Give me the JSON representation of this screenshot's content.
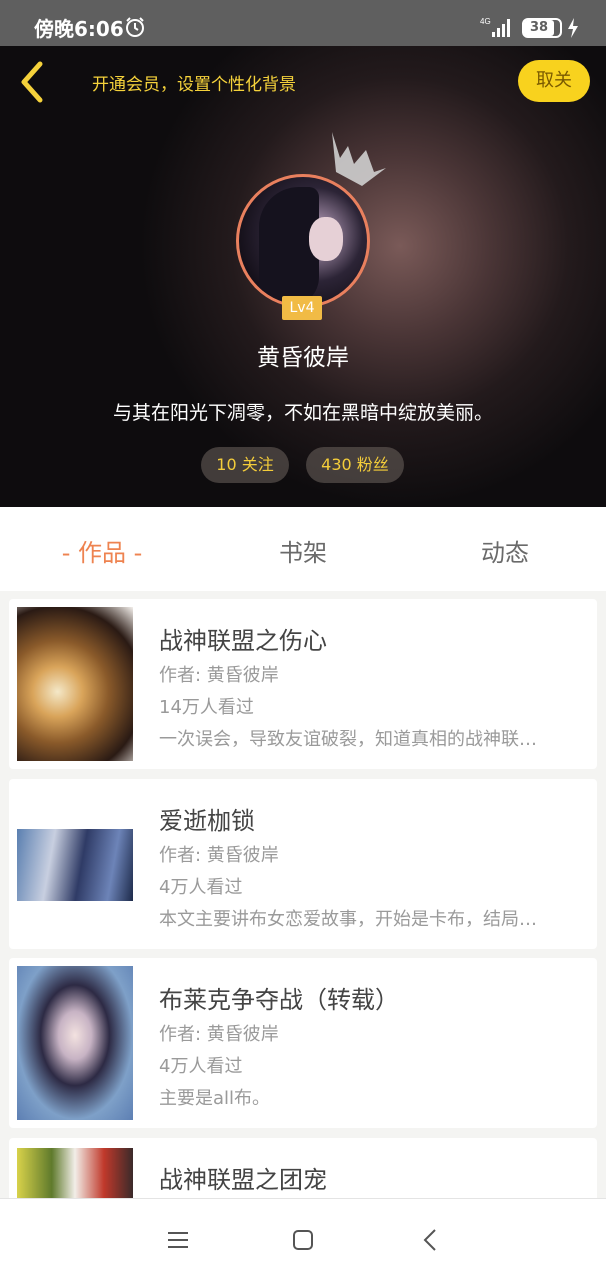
{
  "status_bar": {
    "time": "傍晚6:06",
    "network": "4G",
    "battery": "38"
  },
  "header": {
    "vip_prompt": "开通会员，设置个性化背景",
    "cancel_label": "取关",
    "level": "Lv4",
    "username": "黄昏彼岸",
    "signature": "与其在阳光下凋零，不如在黑暗中绽放美丽。",
    "following": "10 关注",
    "followers": "430 粉丝"
  },
  "tabs": [
    {
      "label": "- 作品 -",
      "active": true
    },
    {
      "label": "书架",
      "active": false
    },
    {
      "label": "动态",
      "active": false
    }
  ],
  "works": [
    {
      "title": "战神联盟之伤心",
      "author": "作者: 黄昏彼岸",
      "views": "14万人看过",
      "desc": "一次误会，导致友谊破裂，知道真相的战神联…"
    },
    {
      "title": "爱逝枷锁",
      "author": "作者: 黄昏彼岸",
      "views": "4万人看过",
      "desc": "本文主要讲布女恋爱故事，开始是卡布，结局…"
    },
    {
      "title": "布莱克争夺战（转载）",
      "author": "作者: 黄昏彼岸",
      "views": "4万人看过",
      "desc": "主要是all布。"
    },
    {
      "title": "战神联盟之团宠",
      "author": "",
      "views": "",
      "desc": ""
    }
  ],
  "colors": {
    "accent": "#ee8350",
    "vip_yellow": "#f8d21e",
    "badge": "#f1bb45"
  },
  "icons": [
    "back-arrow-icon",
    "alarm-icon",
    "signal-icon",
    "battery-icon",
    "charge-icon",
    "crown-icon",
    "menu-icon",
    "home-icon",
    "back-icon"
  ]
}
